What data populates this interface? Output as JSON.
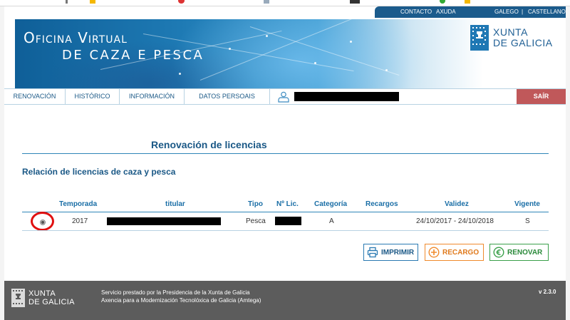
{
  "topbar": {
    "contacto": "CONTACTO",
    "ayuda": "AXUDA",
    "galego": "GALEGO",
    "separator": "|",
    "castellano": "CASTELLANO"
  },
  "banner": {
    "title_line1": "Oficina Virtual",
    "title_line2": "DE CAZA E PESCA"
  },
  "logo": {
    "line1": "XUNTA",
    "line2": "DE GALICIA"
  },
  "nav": {
    "tabs": [
      "RENOVACIÓN",
      "HISTÓRICO",
      "INFORMACIÓN",
      "DATOS PERSOAIS"
    ],
    "logout": "SAÍR"
  },
  "main": {
    "page_title": "Renovación de licencias",
    "section_title": "Relación de licencias de caza y pesca",
    "table": {
      "headers": [
        "Temporada",
        "titular",
        "Tipo",
        "Nº Lic.",
        "Categoría",
        "Recargos",
        "Validez",
        "Vigente"
      ],
      "rows": [
        {
          "temporada": "2017",
          "tipo": "Pesca",
          "categoria": "A",
          "recargos": "",
          "validez": "24/10/2017 - 24/10/2018",
          "vigente": "S"
        }
      ]
    },
    "buttons": {
      "print": "IMPRIMIR",
      "recargo": "RECARGO",
      "renovar": "RENOVAR"
    }
  },
  "footer": {
    "logo_line1": "XUNTA",
    "logo_line2": "DE GALICIA",
    "line1": "Servicio prestado por la Presidencia de la Xunta de Galicia",
    "line2": "Axencia para a Modernización Tecnolóxica de Galicia (Amtega)",
    "version": "v 2.3.0"
  },
  "colors": {
    "brand_blue": "#1a5886",
    "topbar_blue": "#1b5b8c",
    "logout_red": "#c0585a",
    "recargo_orange": "#f08a2c",
    "renovar_green": "#3aa04a",
    "footer_gray": "#5c5c5c"
  },
  "icons": {
    "user": "user-icon",
    "print": "printer-icon",
    "recargo": "plus-circle-icon",
    "renovar": "euro-circle-icon",
    "emblem": "xunta-emblem-icon"
  }
}
